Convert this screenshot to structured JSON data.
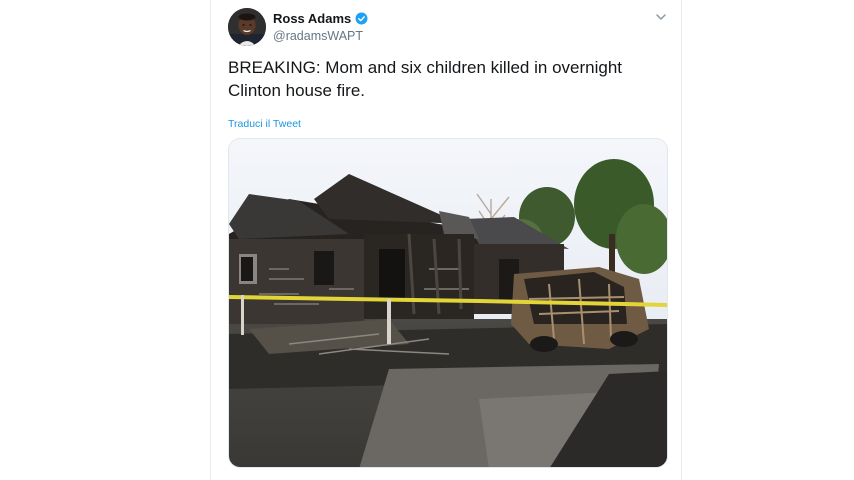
{
  "tweet": {
    "author": {
      "display_name": "Ross Adams",
      "handle": "@radamsWAPT",
      "verified": true
    },
    "text": "BREAKING: Mom and six children killed in overnight Clinton house fire.",
    "translate_label": "Traduci il Tweet",
    "menu_icon": "chevron-down-icon",
    "media": {
      "type": "photo"
    }
  },
  "colors": {
    "link": "#1b95e0",
    "verified": "#1da1f2",
    "text": "#14171a",
    "secondary_text": "#657786",
    "border": "#e6ecf0"
  }
}
